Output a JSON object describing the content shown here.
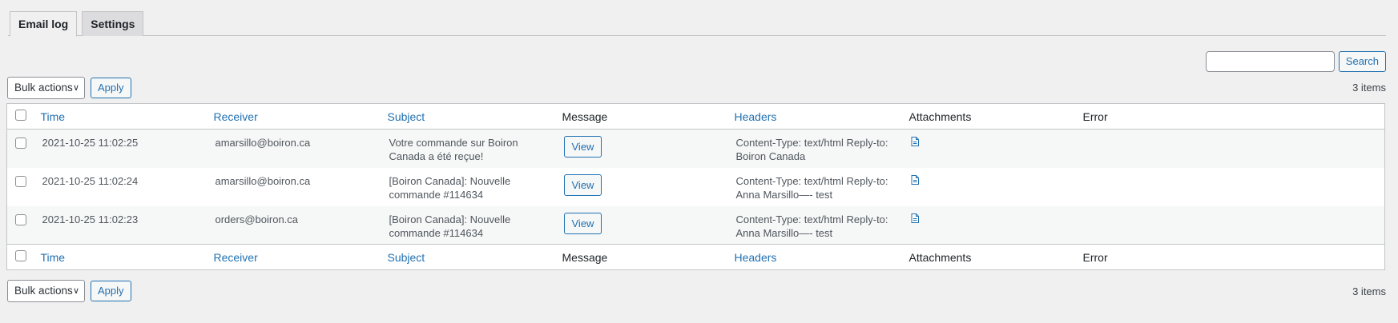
{
  "tabs": [
    {
      "label": "Email log",
      "active": true
    },
    {
      "label": "Settings",
      "active": false
    }
  ],
  "search": {
    "button_label": "Search",
    "placeholder": ""
  },
  "tablenav": {
    "bulk_label": "Bulk actions",
    "apply_label": "Apply",
    "items_count": "3 items"
  },
  "columns": {
    "time": "Time",
    "receiver": "Receiver",
    "subject": "Subject",
    "message": "Message",
    "headers": "Headers",
    "attachments": "Attachments",
    "error": "Error"
  },
  "rows": [
    {
      "time": "2021-10-25 11:02:25",
      "receiver": "amarsillo@boiron.ca",
      "subject": "Votre commande sur Boiron Canada a été reçue!",
      "message_button": "View",
      "headers": "Content-Type: text/html Reply-to: Boiron Canada",
      "attachment_icon": "file-icon",
      "error": ""
    },
    {
      "time": "2021-10-25 11:02:24",
      "receiver": "amarsillo@boiron.ca",
      "subject": "[Boiron Canada]: Nouvelle commande #114634",
      "message_button": "View",
      "headers": "Content-Type: text/html Reply-to: Anna Marsillo—- test",
      "attachment_icon": "file-icon",
      "error": ""
    },
    {
      "time": "2021-10-25 11:02:23",
      "receiver": "orders@boiron.ca",
      "subject": "[Boiron Canada]: Nouvelle commande #114634",
      "message_button": "View",
      "headers": "Content-Type: text/html Reply-to: Anna Marsillo—- test",
      "attachment_icon": "file-icon",
      "error": ""
    }
  ],
  "colors": {
    "link": "#2271b1",
    "background": "#f0f0f1",
    "border": "#c3c4c7"
  }
}
